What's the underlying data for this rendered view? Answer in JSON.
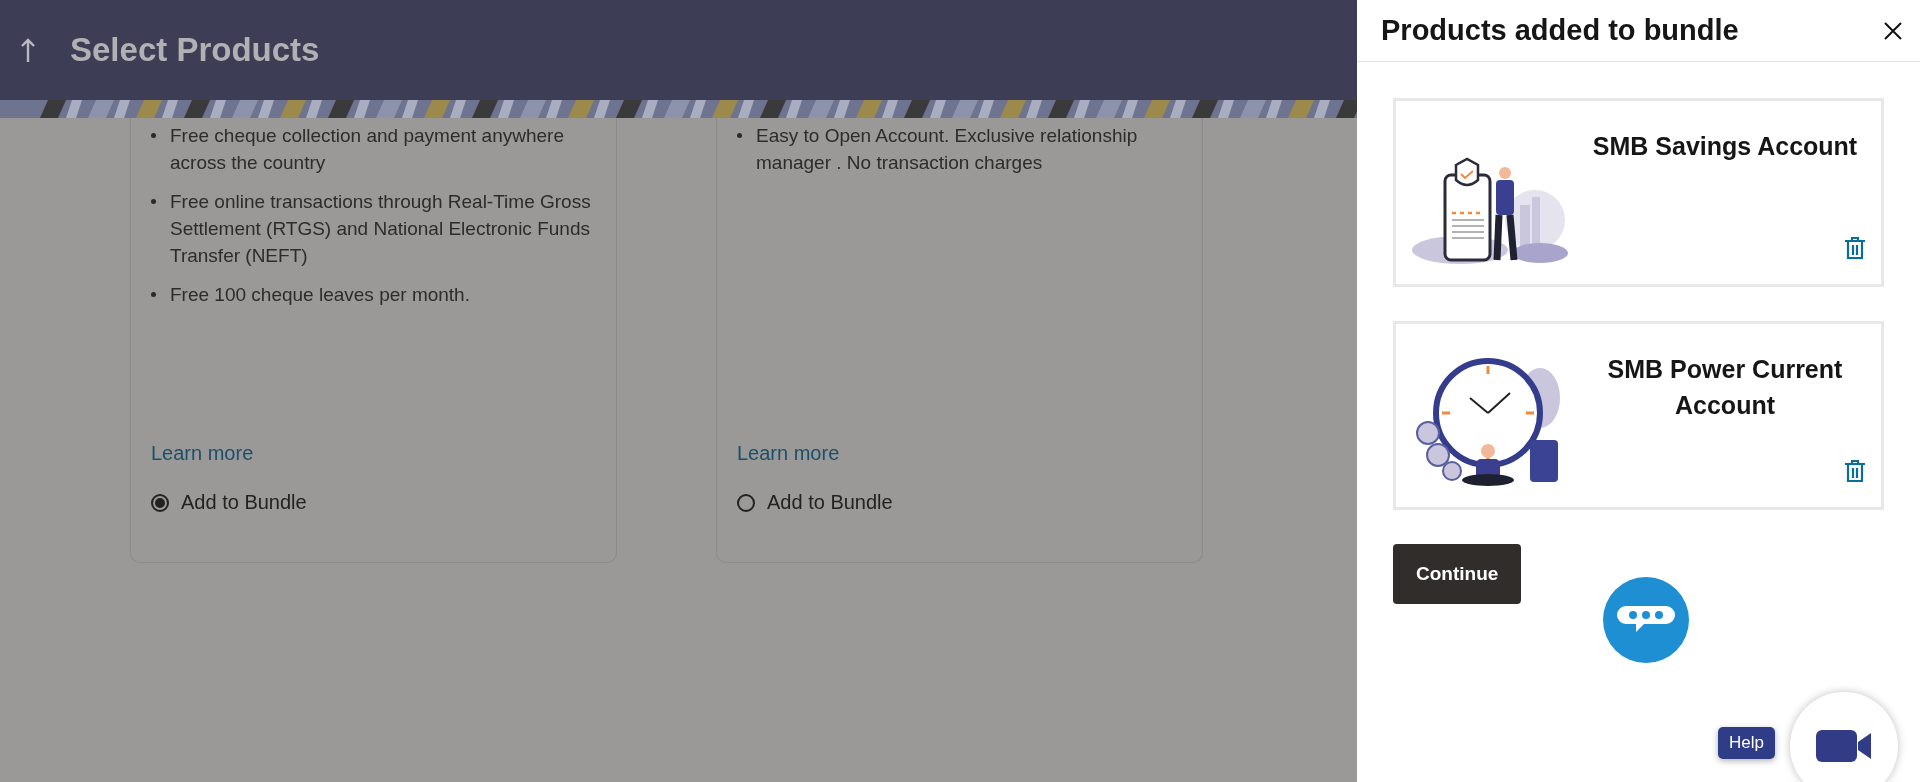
{
  "header": {
    "title": "Select Products"
  },
  "products": [
    {
      "features": [
        "Free cheque collection and payment anywhere across the country",
        "Free online transactions through Real-Time Gross Settlement (RTGS) and National Electronic Funds Transfer (NEFT)",
        "Free 100 cheque leaves per month."
      ],
      "link": "Learn more",
      "option": {
        "label": "Add to Bundle",
        "selected": true
      }
    },
    {
      "features": [
        "Easy to Open Account. Exclusive relationship manager . No transaction charges"
      ],
      "link": "Learn more",
      "option": {
        "label": "Add to Bundle",
        "selected": false
      }
    }
  ],
  "bundle_panel": {
    "title": "Products added to bundle",
    "items": [
      {
        "name": "SMB Savings Account",
        "kind": "savings"
      },
      {
        "name": "SMB Power Current Account",
        "kind": "current"
      }
    ],
    "continue_button": "Continue"
  },
  "help": {
    "label": "Help"
  }
}
